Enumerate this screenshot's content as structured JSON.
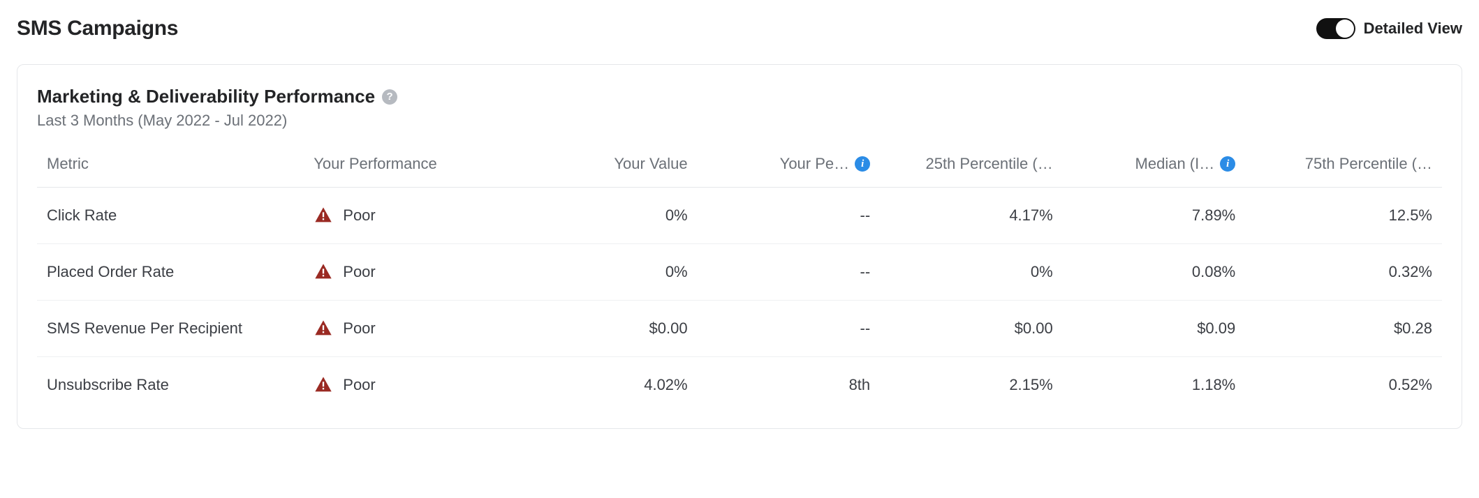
{
  "header": {
    "title": "SMS Campaigns",
    "toggle_label": "Detailed View"
  },
  "card": {
    "title": "Marketing & Deliverability Performance",
    "subtitle": "Last 3 Months (May 2022 - Jul 2022)",
    "help_icon": "help",
    "info_icon_pct": "info",
    "info_icon_med": "info"
  },
  "table": {
    "headers": {
      "metric": "Metric",
      "performance": "Your Performance",
      "value": "Your Value",
      "percentile": "Your Pe…",
      "p25": "25th Percentile (…",
      "median": "Median (I…",
      "p75": "75th Percentile (…"
    },
    "rows": [
      {
        "metric": "Click Rate",
        "performance": "Poor",
        "value": "0%",
        "percentile": "--",
        "p25": "4.17%",
        "median": "7.89%",
        "p75": "12.5%"
      },
      {
        "metric": "Placed Order Rate",
        "performance": "Poor",
        "value": "0%",
        "percentile": "--",
        "p25": "0%",
        "median": "0.08%",
        "p75": "0.32%"
      },
      {
        "metric": "SMS Revenue Per Recipient",
        "performance": "Poor",
        "value": "$0.00",
        "percentile": "--",
        "p25": "$0.00",
        "median": "$0.09",
        "p75": "$0.28"
      },
      {
        "metric": "Unsubscribe Rate",
        "performance": "Poor",
        "value": "4.02%",
        "percentile": "8th",
        "p25": "2.15%",
        "median": "1.18%",
        "p75": "0.52%"
      }
    ]
  },
  "chart_data": {
    "type": "table",
    "title": "Marketing & Deliverability Performance",
    "subtitle": "Last 3 Months (May 2022 - Jul 2022)",
    "columns": [
      "Metric",
      "Your Performance",
      "Your Value",
      "Your Percentile",
      "25th Percentile",
      "Median",
      "75th Percentile"
    ],
    "rows": [
      [
        "Click Rate",
        "Poor",
        "0%",
        null,
        "4.17%",
        "7.89%",
        "12.5%"
      ],
      [
        "Placed Order Rate",
        "Poor",
        "0%",
        null,
        "0%",
        "0.08%",
        "0.32%"
      ],
      [
        "SMS Revenue Per Recipient",
        "Poor",
        "$0.00",
        null,
        "$0.00",
        "$0.09",
        "$0.28"
      ],
      [
        "Unsubscribe Rate",
        "Poor",
        "4.02%",
        "8th",
        "2.15%",
        "1.18%",
        "0.52%"
      ]
    ]
  }
}
